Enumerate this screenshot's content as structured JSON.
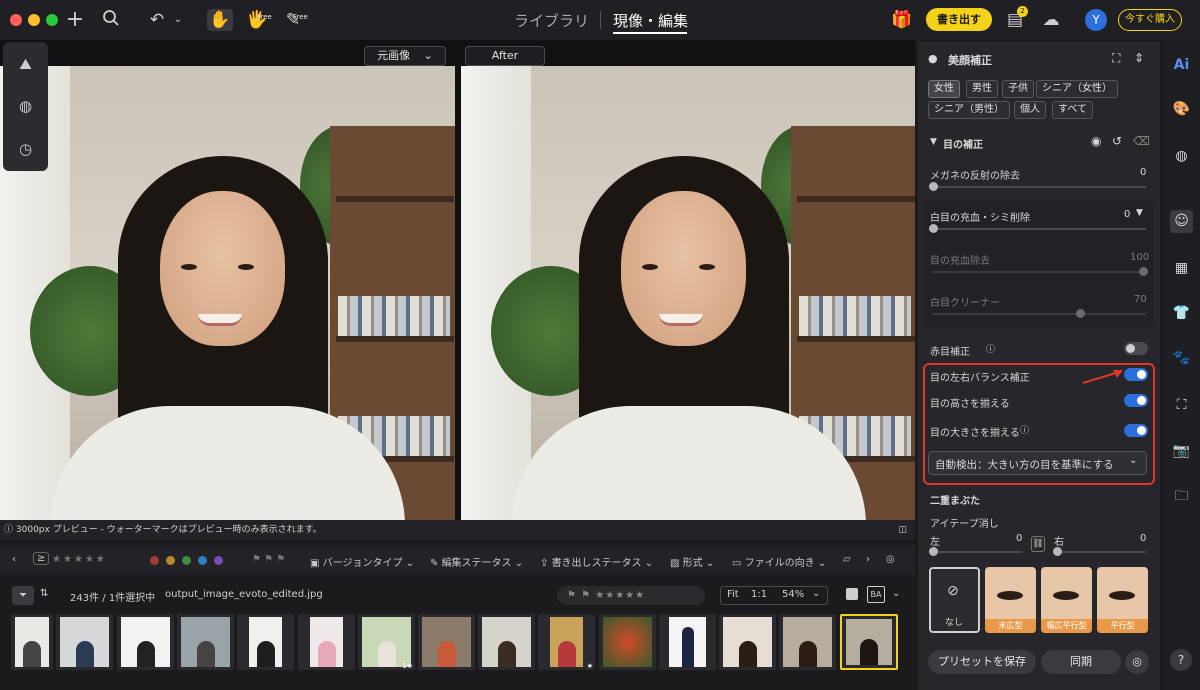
{
  "toolbar": {
    "free_badge_1": "Free",
    "free_badge_2": "Free",
    "tab_library": "ライブラリ",
    "tab_develop": "現像・編集",
    "export_button": "書き出す",
    "notification_count": "2",
    "avatar_letter": "Y",
    "buy_button": "今すぐ購入"
  },
  "canvas": {
    "before_select": "元画像",
    "after_label": "After"
  },
  "info_bar": {
    "text": "3000px プレビュー - ウォーターマークはプレビュー時のみ表示されます。"
  },
  "filter_bar": {
    "gte": "≥",
    "version_type": "バージョンタイプ",
    "edit_status": "編集ステータス",
    "export_status": "書き出しステータス",
    "format": "形式",
    "orientation": "ファイルの向き",
    "color_labels": [
      "#a33a3a",
      "#b58a2c",
      "#3e8e41",
      "#2f7fbf",
      "#7a4fb5"
    ]
  },
  "library_row": {
    "count": "243件 / 1件選択中",
    "filename": "output_image_evoto_edited.jpg",
    "zoom_fit": "Fit",
    "zoom_1to1": "1:1",
    "zoom_value": "54%"
  },
  "filmstrip": {
    "thumbnails": [
      {
        "badge": ""
      },
      {
        "badge": ""
      },
      {
        "badge": ""
      },
      {
        "badge": ""
      },
      {
        "badge": ""
      },
      {
        "badge": ""
      },
      {
        "badge": "1★"
      },
      {
        "badge": ""
      },
      {
        "badge": ""
      },
      {
        "badge": "★"
      },
      {
        "badge": ""
      },
      {
        "badge": ""
      },
      {
        "badge": ""
      },
      {
        "badge": ""
      },
      {
        "badge": ""
      }
    ]
  },
  "panel": {
    "section_title": "美顔補正",
    "chips": [
      "女性",
      "男性",
      "子供",
      "シニア（女性）",
      "シニア（男性）",
      "個人",
      "すべて"
    ],
    "eye_section": "目の補正",
    "glasses_label": "メガネの反射の除去",
    "glasses_value": "0",
    "redness_label": "白目の充血・シミ削除",
    "redness_value": "0",
    "redness_sub_label": "目の充血除去",
    "redness_sub_value": "100",
    "whitening_label": "白目クリーナー",
    "whitening_value": "70",
    "redeye_label": "赤目補正",
    "balance_label": "目の左右バランス補正",
    "height_label": "目の高さを揃える",
    "size_label": "目の大きさを揃える",
    "auto_detect": "自動検出：大きい方の目を基準にする",
    "double_eyelid": "二重まぶた",
    "tape_label": "アイテープ消し",
    "left_label": "左",
    "left_value": "0",
    "right_label": "右",
    "right_value": "0",
    "card_none": "なし",
    "card_1": "末広型",
    "card_2": "幅広平行型",
    "card_3": "平行型",
    "save_preset": "プリセットを保存",
    "sync": "同期"
  },
  "rail": {
    "ai_label": "Ai",
    "help": "?"
  },
  "colors": {
    "accent_blue": "#2d6fdc",
    "export_yellow": "#f5d21a",
    "highlight_red": "#e0362c"
  }
}
